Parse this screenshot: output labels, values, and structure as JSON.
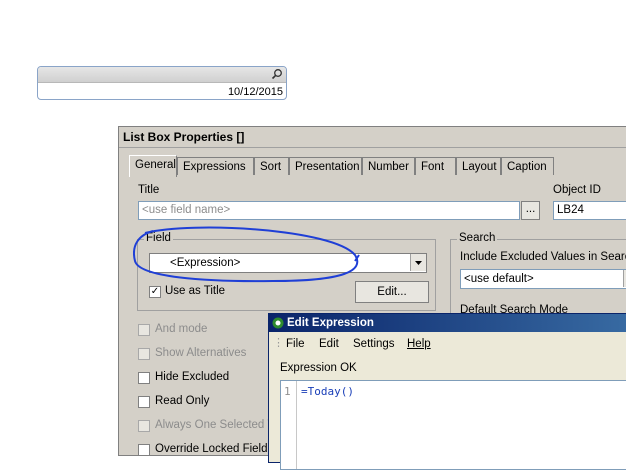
{
  "listbox": {
    "value": "10/12/2015",
    "search_icon": "magnifier-icon"
  },
  "dialog": {
    "title": "List Box Properties []",
    "tabs": [
      "General",
      "Expressions",
      "Sort",
      "Presentation",
      "Number",
      "Font",
      "Layout",
      "Caption"
    ],
    "title_label": "Title",
    "title_placeholder": "<use field name>",
    "title_button": "...",
    "object_id_label": "Object ID",
    "object_id_value": "LB24",
    "field_group_label": "Field",
    "field_value": "<Expression>",
    "use_as_title_label": "Use as Title",
    "use_as_title_checked": true,
    "edit_button": "Edit...",
    "search_group_label": "Search",
    "include_excluded_label": "Include Excluded Values in Search",
    "include_excluded_value": "<use default>",
    "default_search_mode_label": "Default Search Mode",
    "options": [
      {
        "label": "And mode",
        "enabled": false
      },
      {
        "label": "Show Alternatives",
        "enabled": false
      },
      {
        "label": "Hide Excluded",
        "enabled": true
      },
      {
        "label": "Read Only",
        "enabled": true
      },
      {
        "label": "Always One Selected V",
        "enabled": false
      },
      {
        "label": "Override Locked Field",
        "enabled": true
      }
    ],
    "annotation_color": "#1f3fd6"
  },
  "edit_expression": {
    "title": "Edit Expression",
    "menu": [
      "File",
      "Edit",
      "Settings",
      "Help"
    ],
    "status": "Expression OK",
    "line_number": "1",
    "code": "=Today()"
  }
}
